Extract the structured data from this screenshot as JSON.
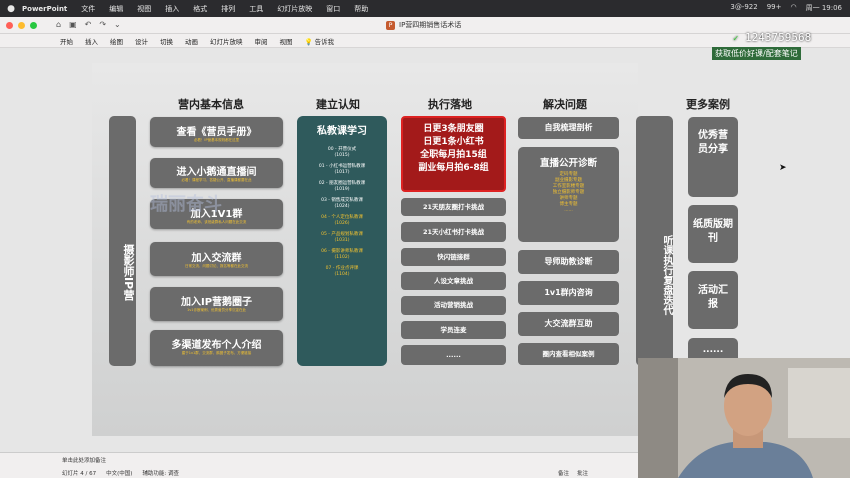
{
  "menubar": {
    "apple": "",
    "app_name": "PowerPoint",
    "items": [
      "文件",
      "编辑",
      "视图",
      "插入",
      "格式",
      "排列",
      "工具",
      "幻灯片放映",
      "窗口",
      "帮助"
    ],
    "status": [
      "3@-922",
      "99+",
      "周一 19:06"
    ]
  },
  "window": {
    "doc_title": "IP营四期销售话术话",
    "quick_access": [
      "⌂",
      "▣",
      "↶",
      "↷",
      "⌄"
    ]
  },
  "ribbon": {
    "tabs": [
      "开始",
      "插入",
      "绘图",
      "设计",
      "切换",
      "动画",
      "幻灯片放映",
      "审阅",
      "视图"
    ],
    "tell_me": "告诉我"
  },
  "overlay": {
    "wx_icon": "✓",
    "id_text": "1243759568",
    "sub_text": "获取低价好课/配套笔记",
    "faint_text": "瑞丽奋斗"
  },
  "slide": {
    "col1_title": "营内基本信息",
    "col2_title": "建立认知",
    "col3_title": "执行落地",
    "col4_title": "解决问题",
    "col5_title": "更多案例",
    "left_vertical": "摄影师IP营",
    "col1_items": [
      {
        "label": "查看《营员手册》",
        "sub": "必看！IP营基本规则都在这里"
      },
      {
        "label": "进入小鹅通直播间",
        "sub": "必看！课程学习、答疑公开、直播课都要在此"
      },
      {
        "label": "加入1V1群",
        "sub": "有的老师，该班级群私人问题在此交流"
      },
      {
        "label": "加入交流群",
        "sub": "日常交流、问题讨论、报名等都在此交流"
      },
      {
        "label": "加入IP营鹅圈子",
        "sub": "1v1诊断案例、优秀营员分享沉淀在此"
      },
      {
        "label": "多渠道发布个人介绍",
        "sub": "建于1v1群、交流群、鹅圈子发布、方便链接"
      }
    ],
    "teal": {
      "title": "私教课学习",
      "items": [
        {
          "text": "00 - 开营仪式",
          "date": "(1015)",
          "yellow": false
        },
        {
          "text": "01 - 小红书运营私教课",
          "date": "(1017)",
          "yellow": false
        },
        {
          "text": "02 - 朋友圈运营私教课",
          "date": "(1019)",
          "yellow": false
        },
        {
          "text": "03 - 销售成交私教课",
          "date": "(1024)",
          "yellow": false
        },
        {
          "text": "04 - 个人定位私教课",
          "date": "(1026)",
          "yellow": true
        },
        {
          "text": "05 - 产品规划私教课",
          "date": "(1031)",
          "yellow": true
        },
        {
          "text": "06 - 摄影讲师私教课",
          "date": "(1102)",
          "yellow": true
        },
        {
          "text": "07 - 作业点评课",
          "date": "(1104)",
          "yellow": true
        }
      ]
    },
    "red_lines": [
      "日更3条朋友圈",
      "日更1条小红书",
      "全职每月拍15组",
      "副业每月拍6-8组"
    ],
    "col3_items": [
      "21天朋友圈打卡挑战",
      "21天小红书打卡挑战",
      "快闪链接群",
      "人设文章挑战",
      "活动营销挑战",
      "学员连麦",
      "......"
    ],
    "col4_top": "自我梳理剖析",
    "live": {
      "title": "直播公开诊断",
      "items": [
        "定码专题",
        "副业摄影专题",
        "工作室影楼专题",
        "独立摄影师专题",
        "讲师专题",
        "博主专题",
        "......"
      ]
    },
    "col4_items": [
      "导师助教诊断",
      "1v1群内咨询",
      "大交流群互助",
      "圈内查看相似案例"
    ],
    "right_vertical": "听课执行复盘迭代",
    "col5_items": [
      "优秀营员分享",
      "纸质版期刊",
      "活动汇报",
      "......"
    ]
  },
  "statusbar": {
    "notes": "单击此处添加备注",
    "slide_info": "幻灯片 4 / 67",
    "lang": "中文(中国)",
    "a11y": "辅助功能: 调查",
    "notes_btn": "备注",
    "comments_btn": "批注"
  },
  "colors": {
    "teal": "#2f5a5c",
    "red": "#a31a1a",
    "gray": "#6b6b6b",
    "yellow": "#f2c230"
  }
}
